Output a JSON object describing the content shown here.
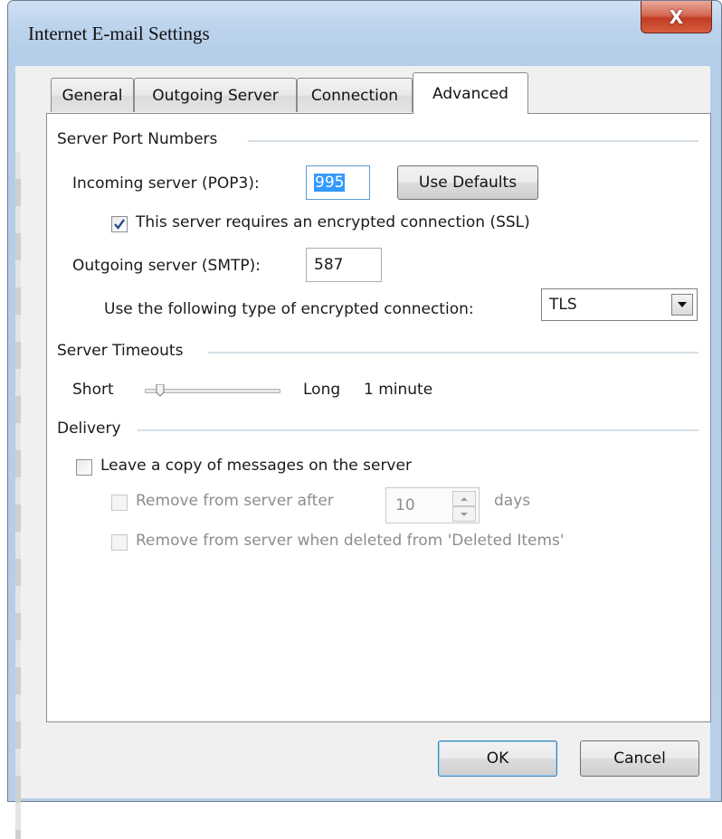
{
  "window": {
    "title": "Internet E-mail Settings",
    "close_glyph": "X"
  },
  "tabs": [
    {
      "label": "General",
      "active": false
    },
    {
      "label": "Outgoing Server",
      "active": false
    },
    {
      "label": "Connection",
      "active": false
    },
    {
      "label": "Advanced",
      "active": true
    }
  ],
  "server_ports": {
    "group_label": "Server Port Numbers",
    "incoming_label": "Incoming server (POP3):",
    "incoming_value": "995",
    "use_defaults_label": "Use Defaults",
    "ssl_label": "This server requires an encrypted connection (SSL)",
    "ssl_checked": true,
    "outgoing_label": "Outgoing server (SMTP):",
    "outgoing_value": "587",
    "encryption_label": "Use the following type of encrypted connection:",
    "encryption_value": "TLS"
  },
  "timeouts": {
    "group_label": "Server Timeouts",
    "short_label": "Short",
    "long_label": "Long",
    "value_text": "1 minute",
    "slider_fraction": 0
  },
  "delivery": {
    "group_label": "Delivery",
    "leave_copy_label": "Leave a copy of messages on the server",
    "leave_copy_checked": false,
    "remove_after_label": "Remove from server after",
    "remove_after_days": "10",
    "days_label": "days",
    "remove_deleted_label": "Remove from server when deleted from 'Deleted Items'"
  },
  "footer": {
    "ok_label": "OK",
    "cancel_label": "Cancel"
  },
  "colors": {
    "accent": "#3399ff",
    "close_red": "#c23c24",
    "window_frame": "#b9cfe7"
  }
}
